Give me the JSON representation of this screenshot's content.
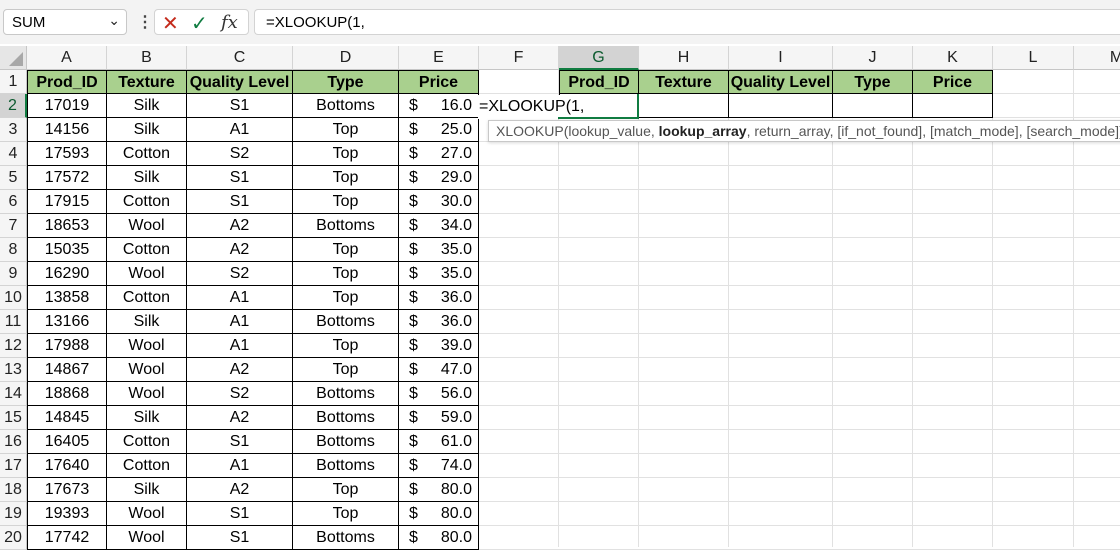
{
  "formula_bar": {
    "name_box": "SUM",
    "formula": "=XLOOKUP(1,"
  },
  "columns": [
    "A",
    "B",
    "C",
    "D",
    "E",
    "F",
    "G",
    "H",
    "I",
    "J",
    "K",
    "L",
    "M"
  ],
  "rows": [
    "1",
    "2",
    "3",
    "4",
    "5",
    "6",
    "7",
    "8",
    "9",
    "10",
    "11",
    "12",
    "13",
    "14",
    "15",
    "16",
    "17",
    "18",
    "19",
    "20"
  ],
  "table": {
    "headers": [
      "Prod_ID",
      "Texture",
      "Quality Level",
      "Type",
      "Price"
    ],
    "currency": "$",
    "rows": [
      [
        "17019",
        "Silk",
        "S1",
        "Bottoms",
        "16.0"
      ],
      [
        "14156",
        "Silk",
        "A1",
        "Top",
        "25.0"
      ],
      [
        "17593",
        "Cotton",
        "S2",
        "Top",
        "27.0"
      ],
      [
        "17572",
        "Silk",
        "S1",
        "Top",
        "29.0"
      ],
      [
        "17915",
        "Cotton",
        "S1",
        "Top",
        "30.0"
      ],
      [
        "18653",
        "Wool",
        "A2",
        "Bottoms",
        "34.0"
      ],
      [
        "15035",
        "Cotton",
        "A2",
        "Top",
        "35.0"
      ],
      [
        "16290",
        "Wool",
        "S2",
        "Top",
        "35.0"
      ],
      [
        "13858",
        "Cotton",
        "A1",
        "Top",
        "36.0"
      ],
      [
        "13166",
        "Silk",
        "A1",
        "Bottoms",
        "36.0"
      ],
      [
        "17988",
        "Wool",
        "A1",
        "Top",
        "39.0"
      ],
      [
        "14867",
        "Wool",
        "A2",
        "Top",
        "47.0"
      ],
      [
        "18868",
        "Wool",
        "S2",
        "Bottoms",
        "56.0"
      ],
      [
        "14845",
        "Silk",
        "A2",
        "Bottoms",
        "59.0"
      ],
      [
        "16405",
        "Cotton",
        "S1",
        "Bottoms",
        "61.0"
      ],
      [
        "17640",
        "Cotton",
        "A1",
        "Bottoms",
        "74.0"
      ],
      [
        "17673",
        "Silk",
        "A2",
        "Top",
        "80.0"
      ],
      [
        "19393",
        "Wool",
        "S1",
        "Top",
        "80.0"
      ],
      [
        "17742",
        "Wool",
        "S1",
        "Bottoms",
        "80.0"
      ]
    ]
  },
  "lookup_table": {
    "headers": [
      "Prod_ID",
      "Texture",
      "Quality Level",
      "Type",
      "Price"
    ]
  },
  "editing_cell": {
    "text": "=XLOOKUP(1,"
  },
  "tooltip": {
    "part1": "XLOOKUP(lookup_value, ",
    "bold": "lookup_array",
    "part2": ", return_array, [if_not_found], [match_mode], [search_mode])"
  },
  "colors": {
    "header_fill": "#a9d08e",
    "accent": "#107c41"
  }
}
